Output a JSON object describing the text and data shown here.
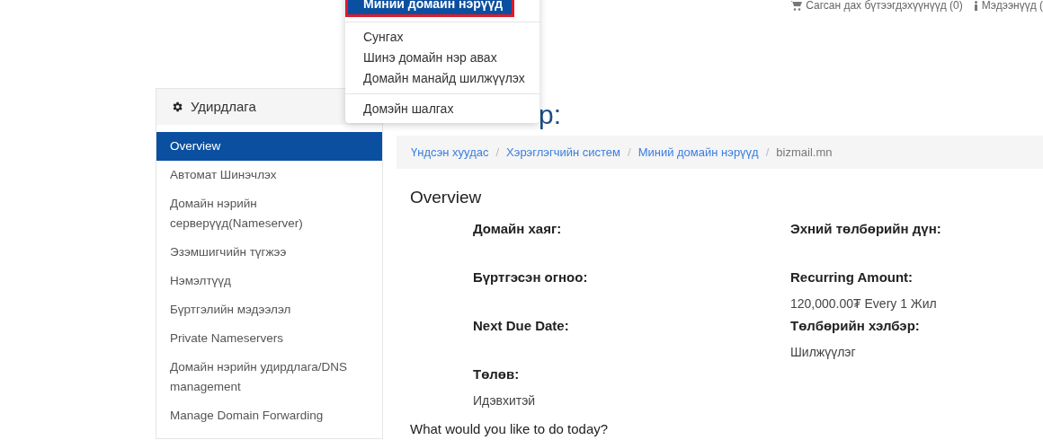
{
  "top_bar": {
    "cart": "Сагсан дах бүтээгдэхүүнүүд (0)",
    "news": "Мэдээнүүд ("
  },
  "dropdown": {
    "items": [
      {
        "label": "Миний домайн нэрүүд",
        "selected": true,
        "highlighted": true
      },
      {
        "label": "Сунгах",
        "selected": false,
        "highlighted": false
      },
      {
        "label": "Шинэ домайн нэр авах",
        "selected": false,
        "highlighted": false
      },
      {
        "label": "Домайн манайд шилжүүлэх",
        "selected": false,
        "highlighted": false
      },
      {
        "label": "Домэйн шалгах",
        "selected": false,
        "highlighted": false
      }
    ]
  },
  "sidebar": {
    "title": "Удирдлага",
    "items": [
      {
        "label": "Overview",
        "selected": true
      },
      {
        "label": "Автомат Шинэчлэх",
        "selected": false
      },
      {
        "label": "Домайн нэрийн серверүүд(Nameserver)",
        "selected": false
      },
      {
        "label": "Эзэмшигчийн түгжээ",
        "selected": false
      },
      {
        "label": "Нэмэлтүүд",
        "selected": false
      },
      {
        "label": "Бүртгэлийн мэдээлэл",
        "selected": false
      },
      {
        "label": "Private Nameservers",
        "selected": false
      },
      {
        "label": "Домайн нэрийн удирдлага/DNS management",
        "selected": false
      },
      {
        "label": "Manage Domain Forwarding",
        "selected": false
      }
    ]
  },
  "page_title": "р:",
  "breadcrumb": [
    {
      "label": "Үндсэн хуудас",
      "current": false
    },
    {
      "separator": "/",
      "label": "Хэрэглэгчийн систем",
      "current": false
    },
    {
      "separator": "/",
      "label": "Миний домайн нэрүүд",
      "current": false
    },
    {
      "separator": "/",
      "label": "bizmail.mn",
      "current": true
    }
  ],
  "overview": {
    "heading": "Overview",
    "left": [
      {
        "label": "Домайн хаяг:"
      },
      {
        "label": "Бүртгэсэн огноо:"
      },
      {
        "label": "Next Due Date:"
      },
      {
        "label": "Төлөв:",
        "value": "Идэвхитэй"
      }
    ],
    "right": [
      {
        "label": "Эхний төлбөрийн дүн:"
      },
      {
        "label": "Recurring Amount:",
        "value": "120,000.00₮ Every 1 Жил"
      },
      {
        "label": "Төлбөрийн хэлбэр:",
        "value": "Шилжүүлэг"
      }
    ]
  },
  "question": "What would you like to do today?"
}
